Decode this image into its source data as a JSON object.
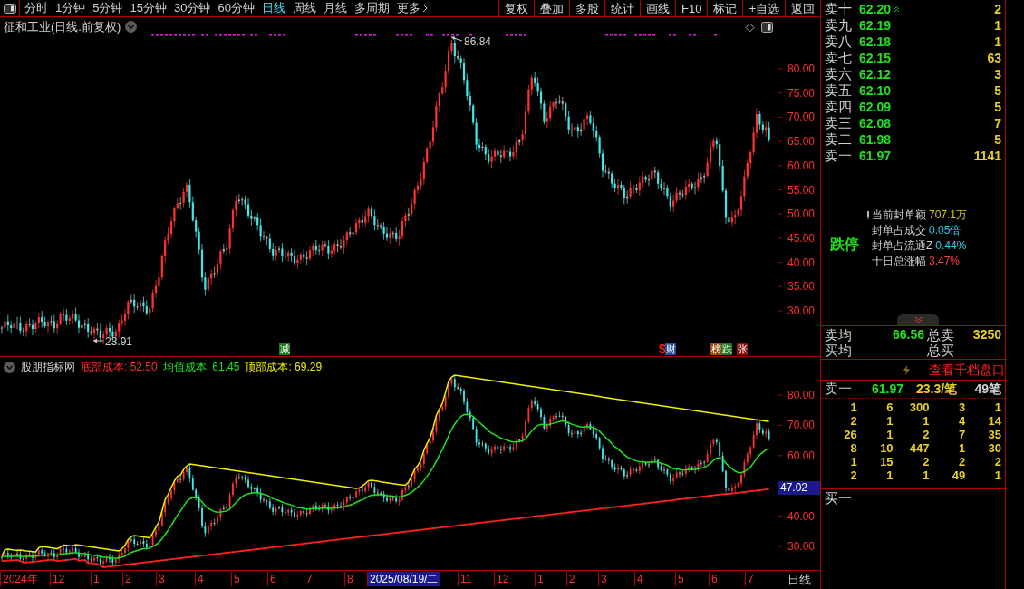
{
  "toolbar": {
    "periods": [
      {
        "label": "分时",
        "selected": false
      },
      {
        "label": "1分钟",
        "selected": false
      },
      {
        "label": "5分钟",
        "selected": false
      },
      {
        "label": "15分钟",
        "selected": false
      },
      {
        "label": "30分钟",
        "selected": false
      },
      {
        "label": "60分钟",
        "selected": false
      },
      {
        "label": "日线",
        "selected": true
      },
      {
        "label": "周线",
        "selected": false
      },
      {
        "label": "月线",
        "selected": false
      },
      {
        "label": "多周期",
        "selected": false
      }
    ],
    "more": "更多",
    "buttons": [
      "复权",
      "叠加",
      "多股",
      "统计",
      "画线",
      "F10",
      "标记",
      "+自选",
      "返回"
    ]
  },
  "chart": {
    "title": "征和工业(日线.前复权)",
    "high_label": "86.84",
    "low_label": "23.91",
    "y_ticks": [
      "80.00",
      "75.00",
      "70.00",
      "65.00",
      "60.00",
      "55.00",
      "50.00",
      "45.00",
      "40.00",
      "35.00",
      "30.00"
    ],
    "event_tags": [
      {
        "text": "减",
        "kind": "badge",
        "color": "#1f7a1f"
      },
      {
        "text": "$",
        "kind": "symbol",
        "color": "#ff2020"
      },
      {
        "text": "财",
        "kind": "badge",
        "color": "#1f4f9a"
      },
      {
        "text": "榜",
        "kind": "badge",
        "color": "#9a4a10"
      },
      {
        "text": "跌",
        "kind": "badge",
        "color": "#1f7a1f"
      },
      {
        "text": "张",
        "kind": "badge",
        "color": "#8a1010"
      }
    ]
  },
  "indicator": {
    "name": "股朋指标网",
    "values": [
      {
        "label": "底部成本: 52.50",
        "color": "#ff2a2a"
      },
      {
        "label": "均值成本: 61.45",
        "color": "#20e020"
      },
      {
        "label": "顶部成本: 69.29",
        "color": "#f0f000"
      }
    ],
    "y_ticks": [
      "80.00",
      "70.00",
      "60.00",
      "40.00",
      "30.00"
    ],
    "cursor_value": "47.02"
  },
  "time_axis": {
    "labels": [
      {
        "text": "2024年",
        "selected": false
      },
      {
        "text": "12",
        "selected": false
      },
      {
        "text": "1",
        "selected": false
      },
      {
        "text": "2",
        "selected": false
      },
      {
        "text": "3",
        "selected": false
      },
      {
        "text": "4",
        "selected": false
      },
      {
        "text": "5",
        "selected": false
      },
      {
        "text": "6",
        "selected": false
      },
      {
        "text": "7",
        "selected": false
      },
      {
        "text": "8",
        "selected": false
      },
      {
        "text": "2025/08/19/二",
        "selected": true
      },
      {
        "text": "11",
        "selected": false
      },
      {
        "text": "12",
        "selected": false
      },
      {
        "text": "1",
        "selected": false
      },
      {
        "text": "2",
        "selected": false
      },
      {
        "text": "3",
        "selected": false
      },
      {
        "text": "4",
        "selected": false
      },
      {
        "text": "5",
        "selected": false
      },
      {
        "text": "6",
        "selected": false
      },
      {
        "text": "7",
        "selected": false
      }
    ],
    "period": "日线"
  },
  "order_book": {
    "asks": [
      {
        "label": "卖十",
        "price": "62.20",
        "volume": "2"
      },
      {
        "label": "卖九",
        "price": "62.19",
        "volume": "1"
      },
      {
        "label": "卖八",
        "price": "62.18",
        "volume": "1"
      },
      {
        "label": "卖七",
        "price": "62.15",
        "volume": "63"
      },
      {
        "label": "卖六",
        "price": "62.12",
        "volume": "3"
      },
      {
        "label": "卖五",
        "price": "62.10",
        "volume": "5"
      },
      {
        "label": "卖四",
        "price": "62.09",
        "volume": "5"
      },
      {
        "label": "卖三",
        "price": "62.08",
        "volume": "7"
      },
      {
        "label": "卖二",
        "price": "61.98",
        "volume": "5"
      },
      {
        "label": "卖一",
        "price": "61.97",
        "volume": "1141"
      }
    ],
    "limit_status": "跌停",
    "seal_stats": [
      {
        "label": "当前封单额",
        "value": "707.1万",
        "color": "#d8c820"
      },
      {
        "label": "封单占成交",
        "value": "0.05倍",
        "color": "#30c8e8"
      },
      {
        "label": "封单占流通Z",
        "value": "0.44%",
        "color": "#30c8e8"
      },
      {
        "label": "十日总涨幅",
        "value": "3.47%",
        "color": "#ff4040"
      }
    ],
    "averages": [
      {
        "label": "卖均",
        "price": "66.56",
        "total_label": "总卖",
        "total": "3250"
      },
      {
        "label": "买均",
        "total_label": "总买"
      }
    ],
    "depth_link": "查看千档盘口",
    "best_ask": {
      "label": "卖一",
      "price": "61.97",
      "per_trade": "23.3/笔",
      "count": "49笔"
    },
    "queue": [
      [
        "1",
        "6",
        "300",
        "3",
        "1"
      ],
      [
        "2",
        "1",
        "1",
        "4",
        "14"
      ],
      [
        "26",
        "1",
        "2",
        "7",
        "35"
      ],
      [
        "8",
        "10",
        "447",
        "1",
        "30"
      ],
      [
        "1",
        "15",
        "2",
        "2",
        "2"
      ],
      [
        "2",
        "1",
        "1",
        "49",
        "1"
      ]
    ],
    "bid_label": "买一"
  }
}
